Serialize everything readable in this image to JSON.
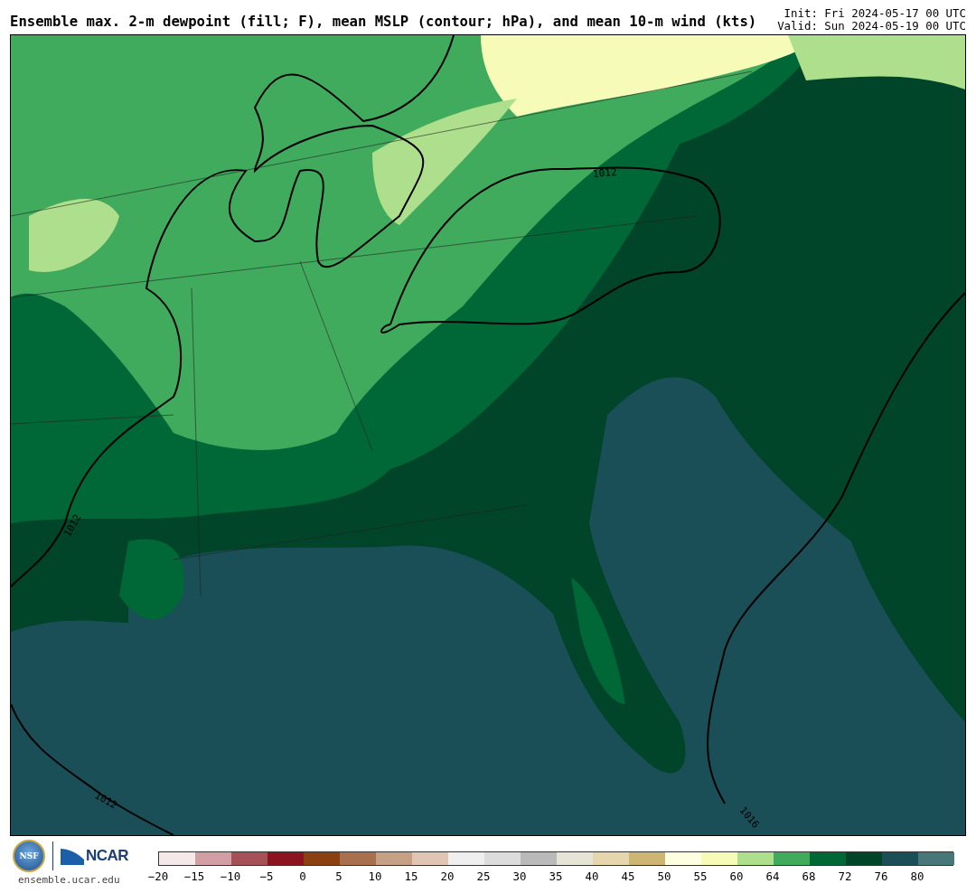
{
  "title": "Ensemble max. 2-m dewpoint (fill; F), mean MSLP (contour; hPa), and mean 10-m wind (kts)",
  "init": "Init: Fri 2024-05-17 00 UTC",
  "valid": "Valid: Sun 2024-05-19 00 UTC",
  "map": {
    "contour_labels": [
      "1012",
      "1012",
      "1012",
      "1016"
    ]
  },
  "logos": {
    "nsf": "NSF",
    "ncar": "NCAR"
  },
  "site": "ensemble.ucar.edu",
  "colorbar": {
    "segments": [
      {
        "color": "#f4e8e9"
      },
      {
        "color": "#d19ea3"
      },
      {
        "color": "#a65157"
      },
      {
        "color": "#8b1420"
      },
      {
        "color": "#8a4010"
      },
      {
        "color": "#a8704c"
      },
      {
        "color": "#c6a085"
      },
      {
        "color": "#e0c5b5"
      },
      {
        "color": "#efefef"
      },
      {
        "color": "#dcdcdc"
      },
      {
        "color": "#b9b9b9"
      },
      {
        "color": "#e6e4d6"
      },
      {
        "color": "#e6d6ae"
      },
      {
        "color": "#cdb574"
      },
      {
        "color": "#fefee0"
      },
      {
        "color": "#f7fbb8"
      },
      {
        "color": "#addf8d"
      },
      {
        "color": "#41ab5d"
      },
      {
        "color": "#006837"
      },
      {
        "color": "#00442a"
      },
      {
        "color": "#1a4f57"
      },
      {
        "color": "#48777a"
      }
    ],
    "ticks": [
      "−20",
      "−15",
      "−10",
      "−5",
      "0",
      "5",
      "10",
      "15",
      "20",
      "25",
      "30",
      "35",
      "40",
      "45",
      "50",
      "55",
      "60",
      "64",
      "68",
      "72",
      "76",
      "80"
    ]
  }
}
